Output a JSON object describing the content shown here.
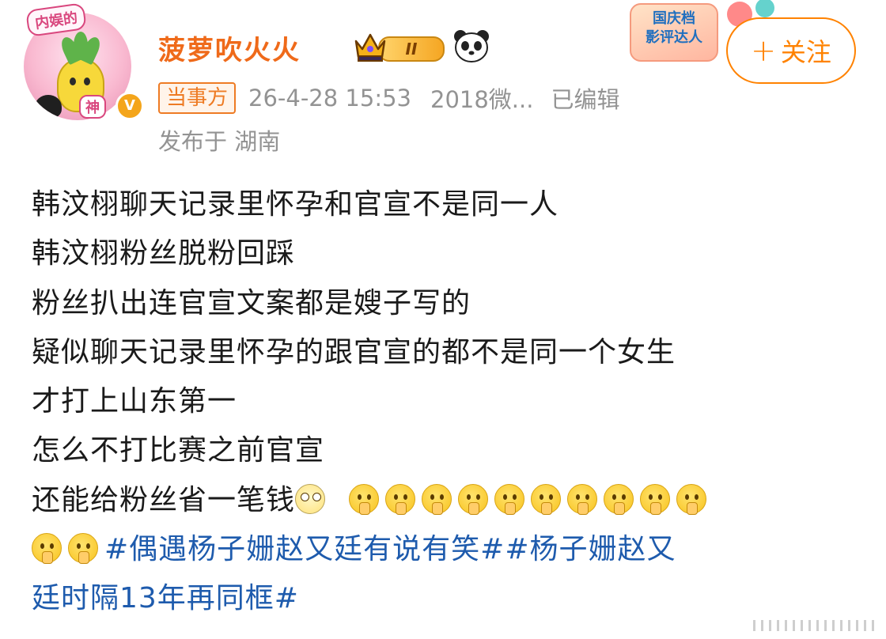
{
  "post": {
    "avatar": {
      "tag_top": "内娱的",
      "tag_bottom": "神"
    },
    "verified_icon": "verified-badge-icon",
    "username": "菠萝吹火火",
    "level_badge": {
      "text": "II",
      "icon": "crown-icon"
    },
    "extra_badge_icon": "panda-icon",
    "event_badge": {
      "line1": "国庆档",
      "line2": "影评达人"
    },
    "follow_button": {
      "plus": "+",
      "label": "关注"
    },
    "meta": {
      "party_tag": "当事方",
      "timestamp": "26-4-28 15:53",
      "source": "2018微...",
      "edited": "已编辑",
      "location": "发布于 湖南"
    },
    "lines": [
      "韩汶栩聊天记录里怀孕和官宣不是同一人",
      "韩汶栩粉丝脱粉回踩",
      "粉丝扒出连官宣文案都是嫂子写的",
      "疑似聊天记录里怀孕的跟官宣的都不是同一个女生",
      "才打上山东第一",
      "怎么不打比赛之前官宣",
      "还能给粉丝省一笔钱"
    ],
    "emoji_names": [
      "laugh-cry-emoji",
      "shush-emoji"
    ],
    "hashtag_1": "#偶遇杨子姗赵又廷有说有笑#",
    "hashtag_2_part1": "#杨子姗赵又",
    "hashtag_2_part2": "廷时隔13年再同框#"
  },
  "colors": {
    "username": "#ef6a1a",
    "follow": "#ff8200",
    "hashtag": "#1e5bad",
    "meta": "#939393"
  }
}
